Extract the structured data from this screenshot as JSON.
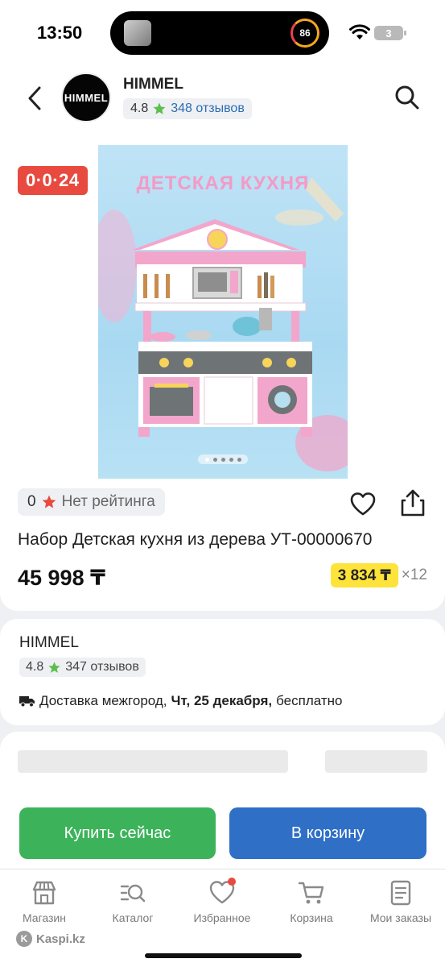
{
  "status_bar": {
    "time": "13:50",
    "activity_ring": "86",
    "battery": "3"
  },
  "header": {
    "back_icon": "chevron-left-icon",
    "shop_logo_text": "HIMMEL",
    "shop_name": "HIMMEL",
    "shop_rating": "4.8",
    "shop_reviews": "348 отзывов",
    "search_icon": "search-icon"
  },
  "product": {
    "timer": "0·0·24",
    "image_title": "ДЕТСКАЯ КУХНЯ",
    "carousel": {
      "count": 5,
      "active_index": 0
    },
    "rating_count": "0",
    "rating_label": "Нет рейтинга",
    "title": "Набор Детская кухня из дерева УТ-00000670",
    "price": "45 998 ₸",
    "installment_amount": "3 834 ₸",
    "installment_months": "×12"
  },
  "seller": {
    "name": "HIMMEL",
    "rating": "4.8",
    "reviews": "347 отзывов",
    "delivery_prefix": "Доставка межгород,",
    "delivery_date": "Чт, 25 декабря,",
    "delivery_suffix": "бесплатно"
  },
  "actions": {
    "buy_now": "Купить сейчас",
    "add_to_cart": "В корзину"
  },
  "tabs": [
    {
      "label": "Магазин",
      "icon": "shop-icon"
    },
    {
      "label": "Каталог",
      "icon": "catalog-search-icon"
    },
    {
      "label": "Избранное",
      "icon": "heart-icon",
      "badge": true
    },
    {
      "label": "Корзина",
      "icon": "cart-icon"
    },
    {
      "label": "Мои заказы",
      "icon": "orders-icon"
    }
  ],
  "brand": "Kaspi.kz",
  "colors": {
    "accent_green": "#3cb35a",
    "accent_blue": "#2f6fc6",
    "timer_red": "#e84a3f",
    "installment_yellow": "#fde33a",
    "link_blue": "#2d6db5"
  }
}
